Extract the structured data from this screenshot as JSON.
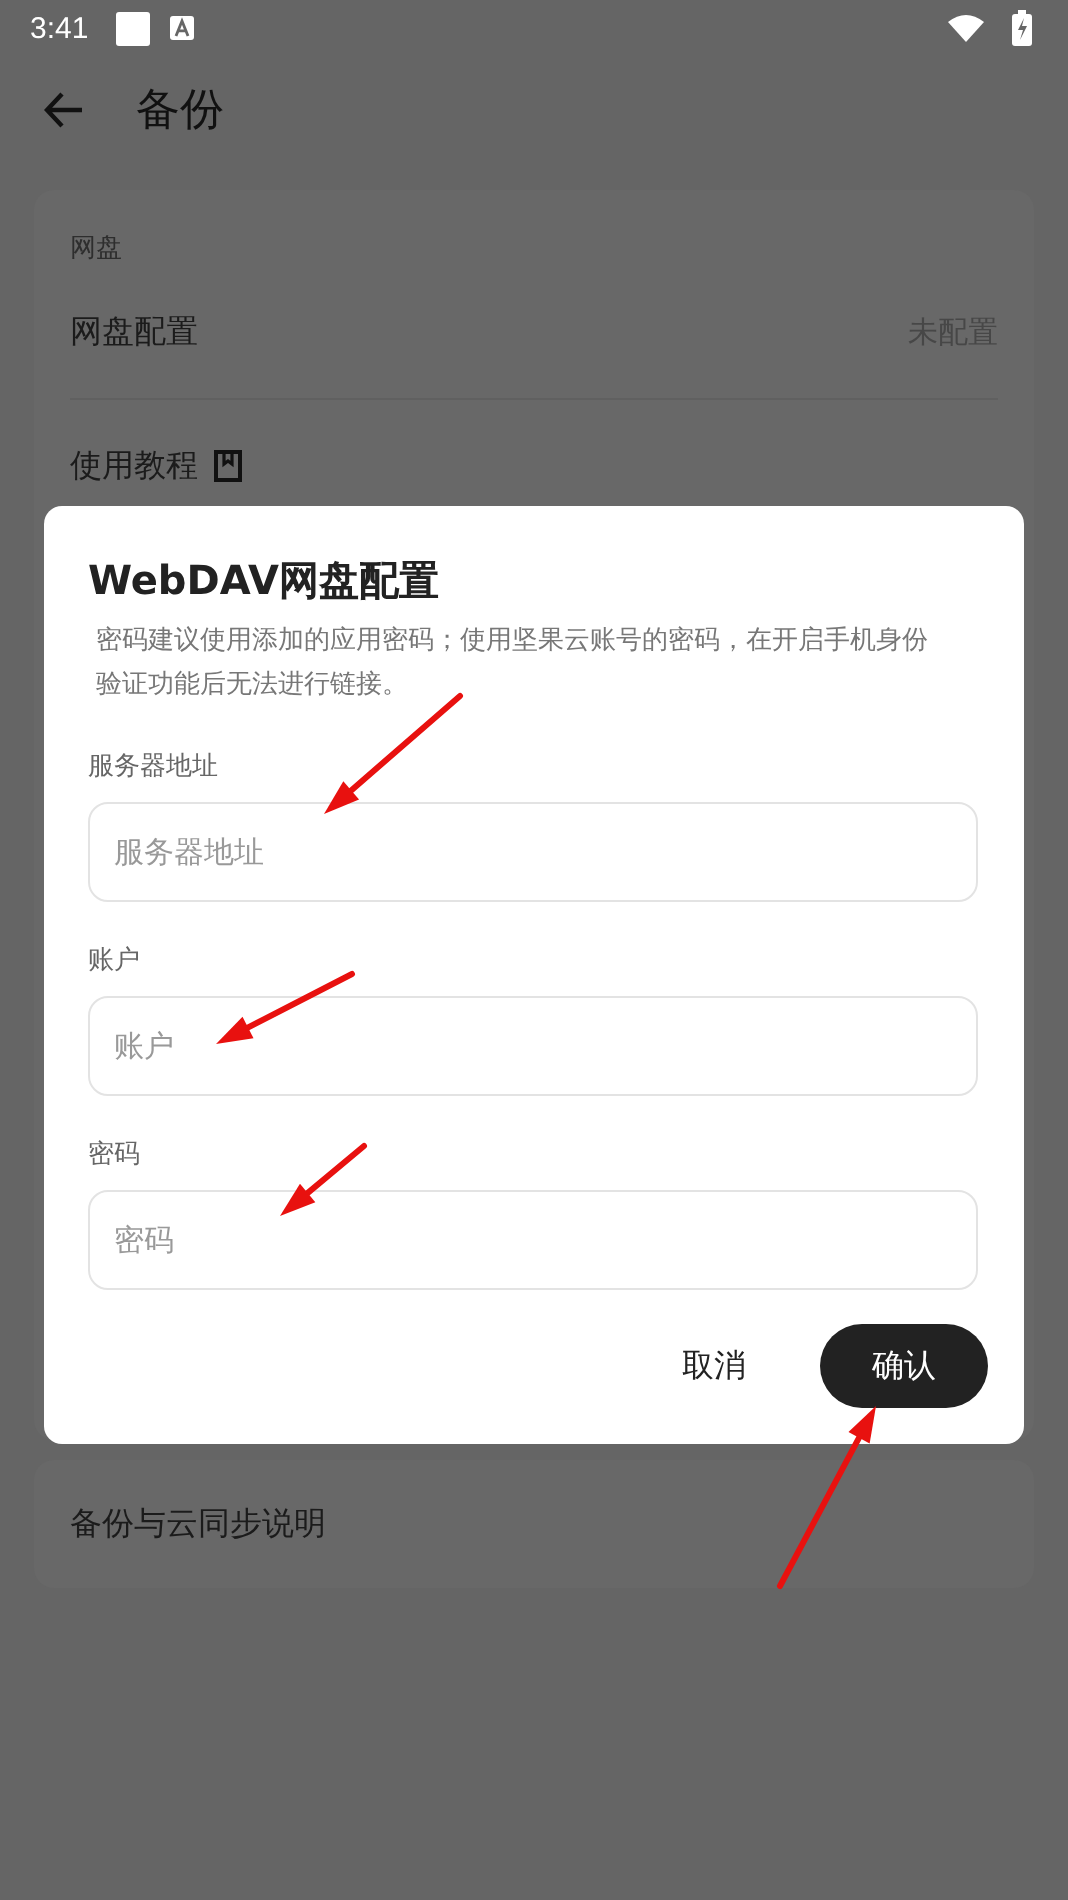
{
  "status_bar": {
    "time": "3:41"
  },
  "app_bar": {
    "title": "备份"
  },
  "settings_card": {
    "header": "网盘",
    "items": [
      {
        "kind": "value",
        "label": "网盘配置",
        "value": "未配置"
      },
      {
        "kind": "link",
        "label": "使用教程"
      }
    ]
  },
  "info_card": {
    "label": "备份与云同步说明"
  },
  "dialog": {
    "title": "WebDAV网盘配置",
    "message": "密码建议使用添加的应用密码；使用坚果云账号的密码，在开启手机身份验证功能后无法进行链接。",
    "fields": [
      {
        "label": "服务器地址",
        "placeholder": "服务器地址"
      },
      {
        "label": "账户",
        "placeholder": "账户"
      },
      {
        "label": "密码",
        "placeholder": "密码"
      }
    ],
    "buttons": [
      {
        "label": "取消",
        "kind": "text"
      },
      {
        "label": "确认",
        "kind": "primary"
      }
    ]
  }
}
